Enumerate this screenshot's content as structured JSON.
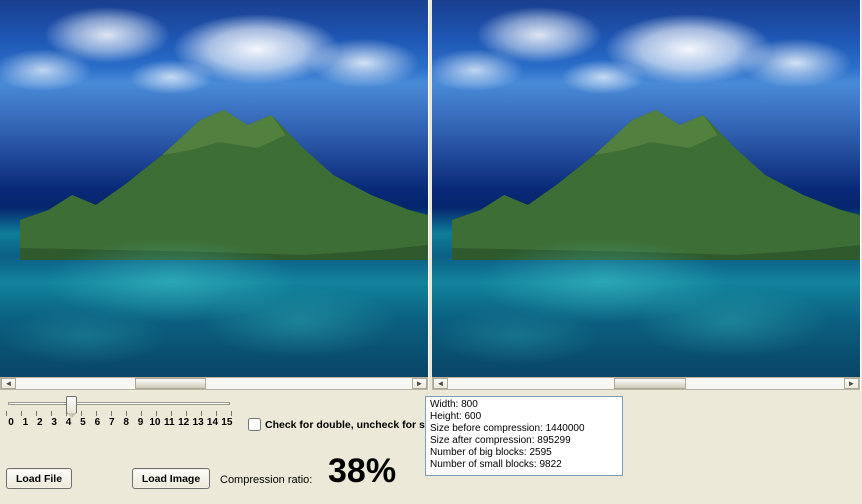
{
  "slider": {
    "ticks": [
      "0",
      "1",
      "2",
      "3",
      "4",
      "5",
      "6",
      "7",
      "8",
      "9",
      "10",
      "11",
      "12",
      "13",
      "14",
      "15"
    ],
    "value": 4
  },
  "checkbox": {
    "label": "Check for double, uncheck for single",
    "checked": false
  },
  "buttons": {
    "load_file": "Load File",
    "load_image": "Load Image"
  },
  "compression": {
    "label": "Compression ratio:",
    "value": "38%"
  },
  "info": {
    "width_label": "Width: ",
    "width": "800",
    "height_label": "Height: ",
    "height": "600",
    "size_before_label": "Size before compression: ",
    "size_before": "1440000",
    "size_after_label": "Size after compression: ",
    "size_after": "895299",
    "big_blocks_label": "Number of big blocks: ",
    "big_blocks": "2595",
    "small_blocks_label": "Number of small blocks: ",
    "small_blocks": "9822"
  },
  "scroll": {
    "left_thumb_pos": "30%",
    "left_thumb_w": "18%",
    "right_thumb_pos": "42%",
    "right_thumb_w": "18%"
  }
}
